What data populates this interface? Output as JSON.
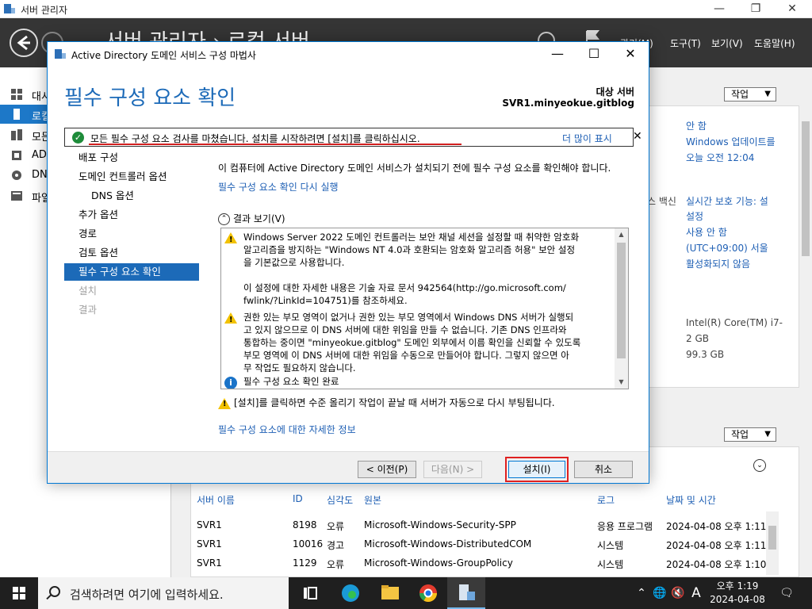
{
  "server_manager": {
    "window_title": "서버 관리자",
    "breadcrumb": "서버 관리자 › 로컬 서버",
    "menus": [
      "관리(M)",
      "도구(T)",
      "보기(V)",
      "도움말(H)"
    ],
    "nav_items": [
      {
        "label": "대시보드",
        "icon": "dashboard-icon"
      },
      {
        "label": "로컬 서버",
        "icon": "local-server-icon"
      },
      {
        "label": "모든 서버",
        "icon": "all-servers-icon"
      },
      {
        "label": "AD DS",
        "icon": "ad-ds-icon"
      },
      {
        "label": "DNS",
        "icon": "dns-icon"
      },
      {
        "label": "파일 및 저장소 서비스",
        "icon": "file-storage-icon"
      }
    ],
    "tasks_label": "작업",
    "properties": {
      "never": "안 함",
      "windows_update": "Windows 업데이트를",
      "update_time": "오늘 오전 12:04",
      "antivirus_prefix": "스 백신",
      "realtime": "실시간 보호 기능: 설",
      "realtime2": "설정",
      "not_used": "사용 안 함",
      "timezone": "(UTC+09:00) 서울",
      "activated": "활성화되지 않음",
      "cpu": "Intel(R) Core(TM) i7-",
      "ram": "2 GB",
      "disk": "99.3 GB"
    },
    "events": {
      "headers": [
        "서버 이름",
        "ID",
        "심각도",
        "원본",
        "로그",
        "날짜 및 시간"
      ],
      "rows": [
        [
          "SVR1",
          "8198",
          "오류",
          "Microsoft-Windows-Security-SPP",
          "응용 프로그램",
          "2024-04-08 오후 1:11:"
        ],
        [
          "SVR1",
          "10016",
          "경고",
          "Microsoft-Windows-DistributedCOM",
          "시스템",
          "2024-04-08 오후 1:11:"
        ],
        [
          "SVR1",
          "1129",
          "오류",
          "Microsoft-Windows-GroupPolicy",
          "시스템",
          "2024-04-08 오후 1:10:"
        ]
      ]
    }
  },
  "wizard": {
    "title": "Active Directory 도메인 서비스 구성 마법사",
    "page_title": "필수 구성 요소 확인",
    "target_label": "대상 서버",
    "target_name": "SVR1.minyeokue.gitblog",
    "banner_text": "모든 필수 구성 요소 검사를 마쳤습니다. 설치를 시작하려면 [설치]를 클릭하십시오.",
    "banner_more": "더 많이 표시",
    "steps": [
      {
        "label": "배포 구성",
        "state": "normal"
      },
      {
        "label": "도메인 컨트롤러 옵션",
        "state": "normal"
      },
      {
        "label": "DNS 옵션",
        "state": "indent"
      },
      {
        "label": "추가 옵션",
        "state": "normal"
      },
      {
        "label": "경로",
        "state": "normal"
      },
      {
        "label": "검토 옵션",
        "state": "normal"
      },
      {
        "label": "필수 구성 요소 확인",
        "state": "active"
      },
      {
        "label": "설치",
        "state": "disabled"
      },
      {
        "label": "결과",
        "state": "disabled"
      }
    ],
    "intro": "이 컴퓨터에 Active Directory 도메인 서비스가 설치되기 전에 필수 구성 요소를 확인해야 합니다.",
    "rerun_link": "필수 구성 요소 확인 다시 실행",
    "results_toggle": "결과 보기(V)",
    "results": {
      "warning1_lines": [
        "Windows Server 2022 도메인 컨트롤러는 보안 채널 세션을 설정할 때 취약한 암호화",
        "알고리즘을 방지하는 \"Windows NT 4.0과 호환되는 암호화 알고리즘 허용\" 보안 설정",
        "을 기본값으로 사용합니다."
      ],
      "warning1_more_lines": [
        "이 설정에 대한 자세한 내용은 기술 자료 문서 942564(http://go.microsoft.com/",
        "fwlink/?LinkId=104751)를 참조하세요."
      ],
      "warning2_lines": [
        "권한 있는 부모 영역이 없거나 권한 있는 부모 영역에서 Windows DNS 서버가 실행되",
        "고 있지 않으므로 이 DNS 서버에 대한 위임을 만들 수 없습니다. 기존 DNS 인프라와",
        "통합하는 중이면 \"minyeokue.gitblog\" 도메인 외부에서 이름 확인을 신뢰할 수 있도록",
        "부모 영역에 이 DNS 서버에 대한 위임을 수동으로 만들어야 합니다. 그렇지 않으면 아",
        "무 작업도 필요하지 않습니다."
      ],
      "info": "필수 구성 요소 확인 완료"
    },
    "reboot_note": "[설치]를 클릭하면 수준 올리기 작업이 끝날 때 서버가 자동으로 다시 부팅됩니다.",
    "more_info_link": "필수 구성 요소에 대한 자세한 정보",
    "buttons": {
      "prev": "< 이전(P)",
      "next": "다음(N) >",
      "install": "설치(I)",
      "cancel": "취소"
    }
  },
  "taskbar": {
    "search_placeholder": "검색하려면 여기에 입력하세요.",
    "ime": "A",
    "time": "오후 1:19",
    "date": "2024-04-08"
  },
  "colors": {
    "accent": "#1c6ab8",
    "link": "#1e5fb4",
    "highlight": "#e02020",
    "header_bg": "#353535"
  }
}
